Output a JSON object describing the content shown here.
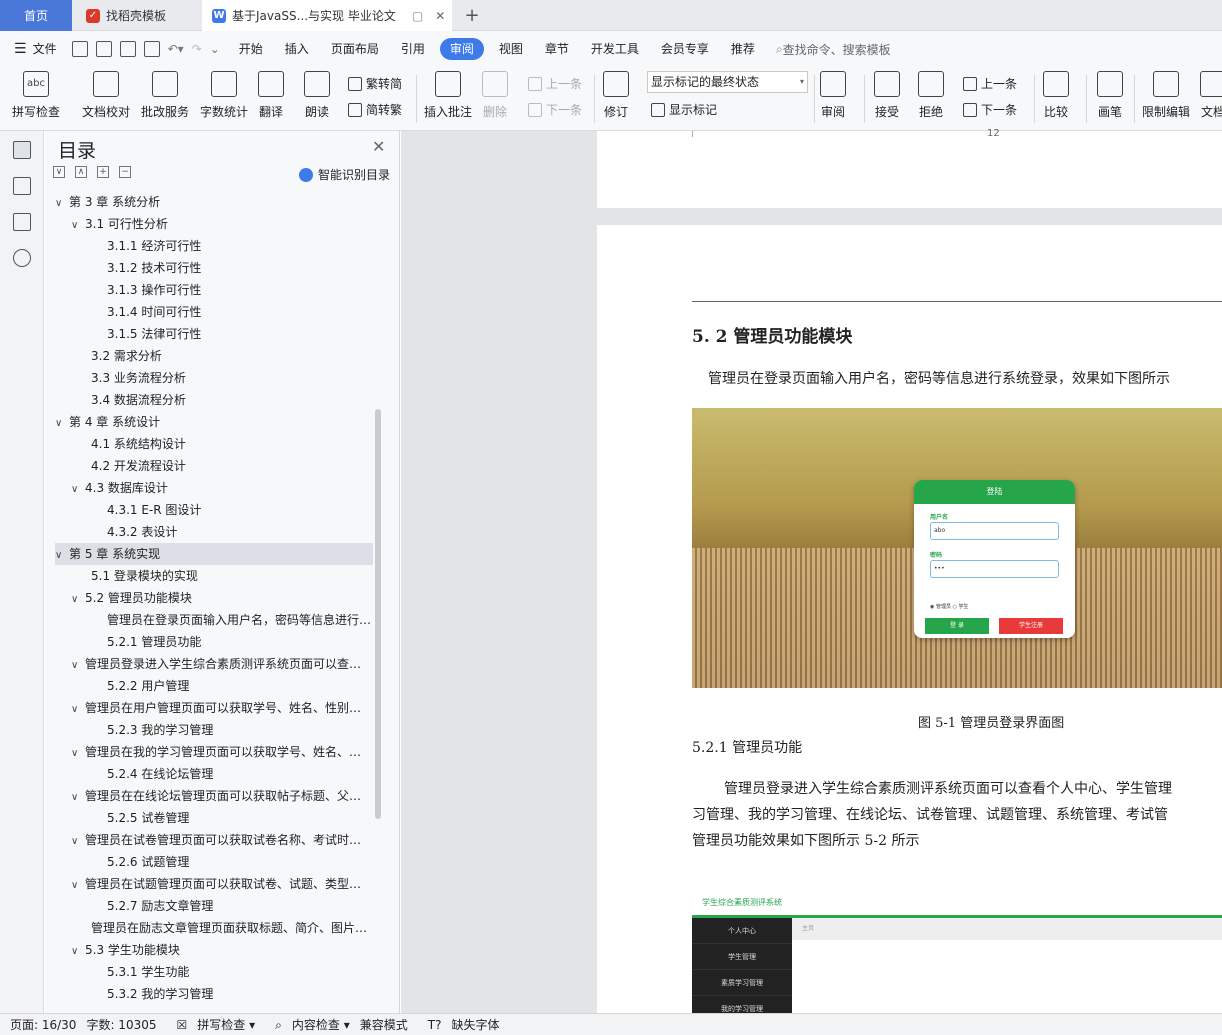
{
  "tabs": {
    "home": "首页",
    "templates": "找稻壳模板",
    "document": "基于JavaSS...与实现 毕业论文",
    "new_tab": "+"
  },
  "menu": {
    "file": "文件",
    "items": [
      "开始",
      "插入",
      "页面布局",
      "引用",
      "审阅",
      "视图",
      "章节",
      "开发工具",
      "会员专享",
      "推荐"
    ],
    "search_placeholder": "查找命令、搜索模板"
  },
  "ribbon": {
    "spell_check": "拼写检查",
    "doc_proof": "文档校对",
    "batch_service": "批改服务",
    "word_count": "字数统计",
    "translate": "翻译",
    "read_aloud": "朗读",
    "trad_to_simp": "繁转简",
    "simp_to_trad": "简转繁",
    "insert_comment": "插入批注",
    "delete": "删除",
    "prev": "上一条",
    "next": "下一条",
    "track_changes": "修订",
    "markup_state": "显示标记的最终状态",
    "show_markup": "显示标记",
    "review": "审阅",
    "accept": "接受",
    "reject": "拒绝",
    "prev2": "上一条",
    "next2": "下一条",
    "compare": "比较",
    "pen": "画笔",
    "restrict_edit": "限制编辑",
    "doc_more": "文档"
  },
  "toc": {
    "title": "目录",
    "smart": "智能识别目录",
    "items": [
      {
        "text": "第 3 章  系统分析",
        "level": 1,
        "arrow": "∨"
      },
      {
        "text": "3.1 可行性分析",
        "level": 2,
        "arrow": "∨"
      },
      {
        "text": "3.1.1 经济可行性",
        "level": 3,
        "arrow": ""
      },
      {
        "text": "3.1.2 技术可行性",
        "level": 3,
        "arrow": ""
      },
      {
        "text": "3.1.3 操作可行性",
        "level": 3,
        "arrow": ""
      },
      {
        "text": "3.1.4  时间可行性",
        "level": 3,
        "arrow": ""
      },
      {
        "text": "3.1.5  法律可行性",
        "level": 3,
        "arrow": ""
      },
      {
        "text": "3.2 需求分析",
        "level": 2,
        "arrow": ""
      },
      {
        "text": "3.3 业务流程分析",
        "level": 2,
        "arrow": ""
      },
      {
        "text": "3.4 数据流程分析",
        "level": 2,
        "arrow": ""
      },
      {
        "text": "第 4 章  系统设计",
        "level": 1,
        "arrow": "∨"
      },
      {
        "text": "4.1 系统结构设计",
        "level": 2,
        "arrow": ""
      },
      {
        "text": "4.2 开发流程设计",
        "level": 2,
        "arrow": ""
      },
      {
        "text": "4.3 数据库设计",
        "level": 2,
        "arrow": "∨"
      },
      {
        "text": "4.3.1 E-R 图设计",
        "level": 3,
        "arrow": ""
      },
      {
        "text": "4.3.2 表设计",
        "level": 3,
        "arrow": ""
      },
      {
        "text": "第 5 章    系统实现",
        "level": 1,
        "arrow": "∨",
        "selected": true
      },
      {
        "text": "5.1 登录模块的实现",
        "level": 2,
        "arrow": ""
      },
      {
        "text": "5.2 管理员功能模块",
        "level": 2,
        "arrow": "∨"
      },
      {
        "text": "管理员在登录页面输入用户名，密码等信息进行系统登录，效果如下图所示",
        "level": 3,
        "arrow": ""
      },
      {
        "text": "5.2.1 管理员功能",
        "level": 3,
        "arrow": ""
      },
      {
        "text": "管理员登录进入学生综合素质测评系统页面可以查看个人中心、学生管理",
        "level": 2,
        "arrow": "∨"
      },
      {
        "text": "5.2.2 用户管理",
        "level": 3,
        "arrow": ""
      },
      {
        "text": "管理员在用户管理页面可以获取学号、姓名、性别等信息",
        "level": 2,
        "arrow": "∨"
      },
      {
        "text": "5.2.3 我的学习管理",
        "level": 3,
        "arrow": ""
      },
      {
        "text": "管理员在我的学习管理页面可以获取学号、姓名、等信息",
        "level": 2,
        "arrow": "∨"
      },
      {
        "text": "5.2.4 在线论坛管理",
        "level": 3,
        "arrow": ""
      },
      {
        "text": "管理员在在线论坛管理页面可以获取帖子标题、父节点等信息",
        "level": 2,
        "arrow": "∨"
      },
      {
        "text": "5.2.5 试卷管理",
        "level": 3,
        "arrow": ""
      },
      {
        "text": "管理员在试卷管理页面可以获取试卷名称、考试时长等信息",
        "level": 2,
        "arrow": "∨"
      },
      {
        "text": "5.2.6 试题管理",
        "level": 3,
        "arrow": ""
      },
      {
        "text": "管理员在试题管理页面可以获取试卷、试题、类型等信息",
        "level": 2,
        "arrow": "∨"
      },
      {
        "text": "5.2.7 励志文章管理",
        "level": 3,
        "arrow": ""
      },
      {
        "text": "管理员在励志文章管理页面获取标题、简介、图片等信息",
        "level": 2,
        "arrow": ""
      },
      {
        "text": "5.3 学生功能模块",
        "level": 2,
        "arrow": "∨"
      },
      {
        "text": "5.3.1 学生功能",
        "level": 3,
        "arrow": ""
      },
      {
        "text": "5.3.2 我的学习管理",
        "level": 3,
        "arrow": ""
      }
    ]
  },
  "doc": {
    "page_number": "12",
    "heading": "5. 2 管理员功能模块",
    "para1": "管理员在登录页面输入用户名，密码等信息进行系统登录，效果如下图所示",
    "login": {
      "title": "登陆",
      "user_label": "用户名",
      "user_value": "abo",
      "pwd_label": "密码",
      "pwd_value": "•••",
      "radio": "◉ 管理员  ○ 学生",
      "login_btn": "登 录",
      "register_btn": "学生注册"
    },
    "caption1": "图 5-1 管理员登录界面图",
    "sub_heading": "5.2.1 管理员功能",
    "para2_line1": "管理员登录进入学生综合素质测评系统页面可以查看个人中心、学生管理",
    "para2_line2": "习管理、我的学习管理、在线论坛、试卷管理、试题管理、系统管理、考试管",
    "para2_line3": "管理员功能效果如下图所示 5-2 所示",
    "fig2": {
      "title": "学生综合素质测评系统",
      "menu": [
        "个人中心",
        "学生管理",
        "素质学习管理",
        "我的学习管理"
      ],
      "main": "主页"
    }
  },
  "status": {
    "page": "页面: 16/30",
    "words": "字数: 10305",
    "spell": "拼写检查",
    "content_check": "内容检查",
    "compat": "兼容模式",
    "missing_font": "缺失字体"
  }
}
